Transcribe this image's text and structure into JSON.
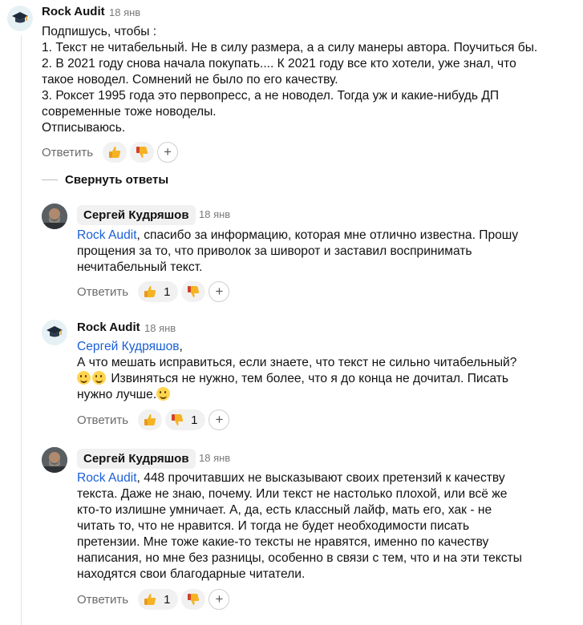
{
  "collapse_label": "Свернуть ответы",
  "comments": [
    {
      "author": "Rock Audit",
      "date": "18 янв",
      "lines": [
        "Подпишусь, чтобы :",
        "1. Текст не читабельный. Не в силу размера, а а силу манеры автора. Поучиться бы.",
        "2. В 2021 году снова начала покупать.... К 2021 году все кто хотели, уже знал, что",
        "такое новодел. Сомнений не было по его качеству.",
        "3. Роксет 1995 года это первопресс, а не новодел. Тогда уж и какие-нибудь ДП",
        "современные тоже новоделы.",
        "Отписываюсь."
      ],
      "reply_label": "Ответить",
      "likes": "",
      "dislikes": "",
      "add_label": "+"
    },
    {
      "author": "Сергей Кудряшов",
      "date": "18 янв",
      "mention": "Rock Audit",
      "lines": [
        ", спасибо за информацию, которая мне отлично известна. Прошу",
        "прощения за то, что приволок за шиворот и заставил воспринимать",
        "нечитабельный текст."
      ],
      "reply_label": "Ответить",
      "likes": "1",
      "dislikes": "",
      "add_label": "+"
    },
    {
      "author": "Rock Audit",
      "date": "18 янв",
      "mention": "Сергей Кудряшов",
      "lines": [
        ",",
        "А что мешать исправиться, если знаете, что текст не сильно читабельный?",
        " Извиняться не нужно, тем более, что я до конца не дочитал. Писать",
        "нужно лучше."
      ],
      "reply_label": "Ответить",
      "likes": "",
      "dislikes": "1",
      "add_label": "+"
    },
    {
      "author": "Сергей Кудряшов",
      "date": "18 янв",
      "mention": "Rock Audit",
      "lines": [
        ", 448 прочитавших не высказывают своих претензий к качеству",
        "текста. Даже не знаю, почему. Или текст не настолько плохой, или всё же",
        "кто-то излишне умничает. А, да, есть классный лайф, мать его, хак - не",
        "читать то, что не нравится. И тогда не будет необходимости писать",
        "претензии. Мне тоже какие-то тексты не нравятся, именно по качеству",
        "написания, но мне без разницы, особенно в связи с тем, что и на эти тексты",
        "находятся свои благодарные читатели."
      ],
      "reply_label": "Ответить",
      "likes": "1",
      "dislikes": "",
      "add_label": "+"
    }
  ]
}
